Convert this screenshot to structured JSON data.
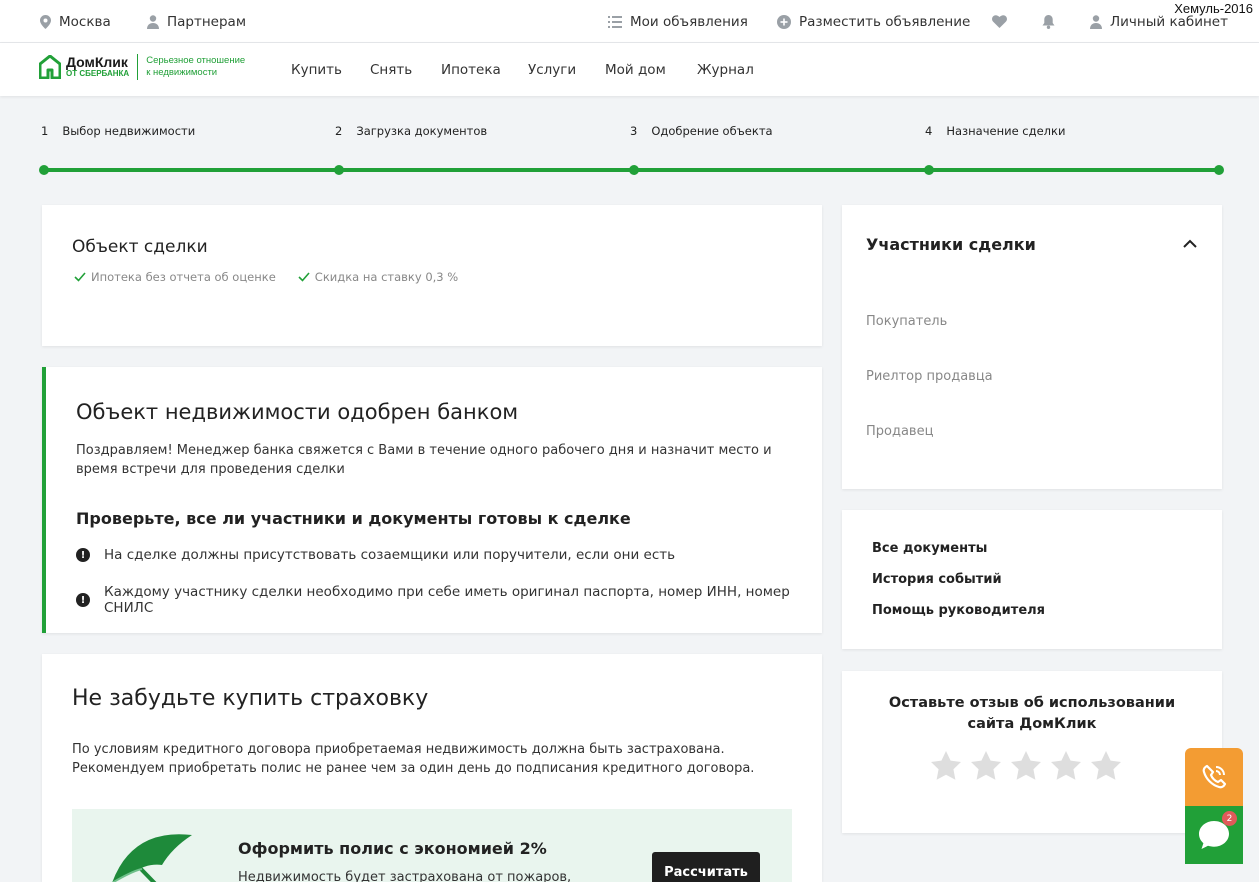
{
  "watermark": "Хемуль-2016",
  "topbar": {
    "city": "Москва",
    "partners": "Партнерам",
    "my_ads": "Мои объявления",
    "post_ad": "Разместить объявление",
    "cabinet": "Личный кабинет"
  },
  "logo": {
    "name": "ДомКлик",
    "sub": "ОТ СБЕРБАНКА",
    "slogan_line1": "Серьезное отношение",
    "slogan_line2": "к недвижимости"
  },
  "nav": [
    "Купить",
    "Снять",
    "Ипотека",
    "Услуги",
    "Мой дом",
    "Журнал"
  ],
  "steps": [
    {
      "num": "1",
      "label": "Выбор недвижимости"
    },
    {
      "num": "2",
      "label": "Загрузка документов"
    },
    {
      "num": "3",
      "label": "Одобрение объекта"
    },
    {
      "num": "4",
      "label": "Назначение сделки"
    }
  ],
  "deal_object": {
    "title": "Объект сделки",
    "features": [
      "Ипотека без отчета об оценке",
      "Скидка на ставку 0,3 %"
    ]
  },
  "approved": {
    "title": "Объект недвижимости одобрен банком",
    "text": "Поздравляем! Менеджер банка свяжется с Вами в течение одного рабочего дня и назначит место и время встречи для проведения сделки",
    "check_title": "Проверьте, все ли участники и документы готовы к сделке",
    "bullets": [
      "На сделке должны присутствовать созаемщики или поручители, если они есть",
      "Каждому участнику сделки необходимо при себе иметь оригинал паспорта, номер ИНН, номер СНИЛС"
    ]
  },
  "insurance": {
    "title": "Не забудьте купить страховку",
    "text_line1": "По условиям кредитного договора приобретаемая недвижимость должна быть застрахована.",
    "text_line2": "Рекомендуем приобретать полис не ранее чем за один день до подписания кредитного договора.",
    "promo_title": "Оформить полис с экономией 2%",
    "promo_text": "Недвижимость будет застрахована от пожаров,",
    "button": "Рассчитать"
  },
  "participants": {
    "title": "Участники сделки",
    "roles": [
      "Покупатель",
      "Риелтор продавца",
      "Продавец"
    ]
  },
  "links": [
    "Все документы",
    "История событий",
    "Помощь руководителя"
  ],
  "feedback": {
    "line1": "Оставьте отзыв об использовании",
    "line2": "сайта ДомКлик",
    "rating": 0,
    "max_rating": 5
  },
  "chat_badge": "2",
  "colors": {
    "accent": "#21a038",
    "orange": "#f39c33",
    "dark_button": "#1f1f1f"
  }
}
